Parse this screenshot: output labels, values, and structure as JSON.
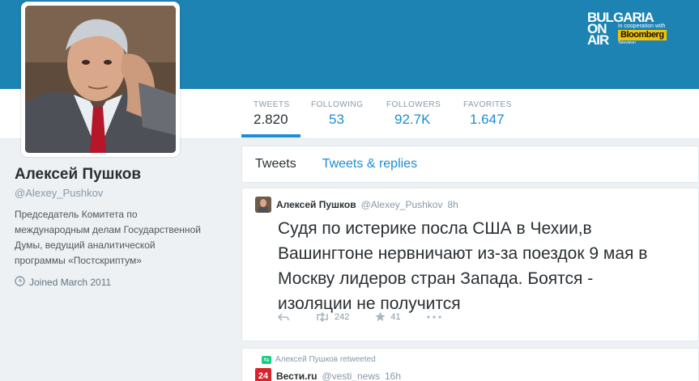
{
  "watermark": {
    "line1": "BULGARIA",
    "on": "ON",
    "air": "AIR",
    "coop": "in cooperation with",
    "brand": "Bloomberg",
    "tag": "Television"
  },
  "stats": [
    {
      "label": "TWEETS",
      "value": "2.820",
      "active": true
    },
    {
      "label": "FOLLOWING",
      "value": "53",
      "active": false
    },
    {
      "label": "FOLLOWERS",
      "value": "92.7K",
      "active": false
    },
    {
      "label": "FAVORITES",
      "value": "1.647",
      "active": false
    }
  ],
  "profile": {
    "name": "Алексей Пушков",
    "handle": "@Alexey_Pushkov",
    "bio": "Председатель Комитета по международным делам Государственной Думы, ведущий аналитической программы «Постскриптум»",
    "joined": "Joined March 2011"
  },
  "tabs": [
    {
      "label": "Tweets",
      "active": true
    },
    {
      "label": "Tweets & replies",
      "active": false
    }
  ],
  "tweet1": {
    "name": "Алексей Пушков",
    "handle": "@Alexey_Pushkov",
    "time": "8h",
    "text": "Судя по истерике посла США в Чехии,в Вашингтоне нервничают из-за поездок 9 мая в Москву лидеров стран Запада. Боятся - изоляции не получится",
    "retweets": "242",
    "favorites": "41"
  },
  "tweet2": {
    "retweeted_by": "Алексей Пушков retweeted",
    "logo": "24",
    "name": "Вести.ru",
    "handle": "@vesti_news",
    "time": "16h"
  },
  "colors": {
    "banner": "#1d83b3",
    "accent": "#1d8dd6",
    "brand_yellow": "#f4c300"
  }
}
